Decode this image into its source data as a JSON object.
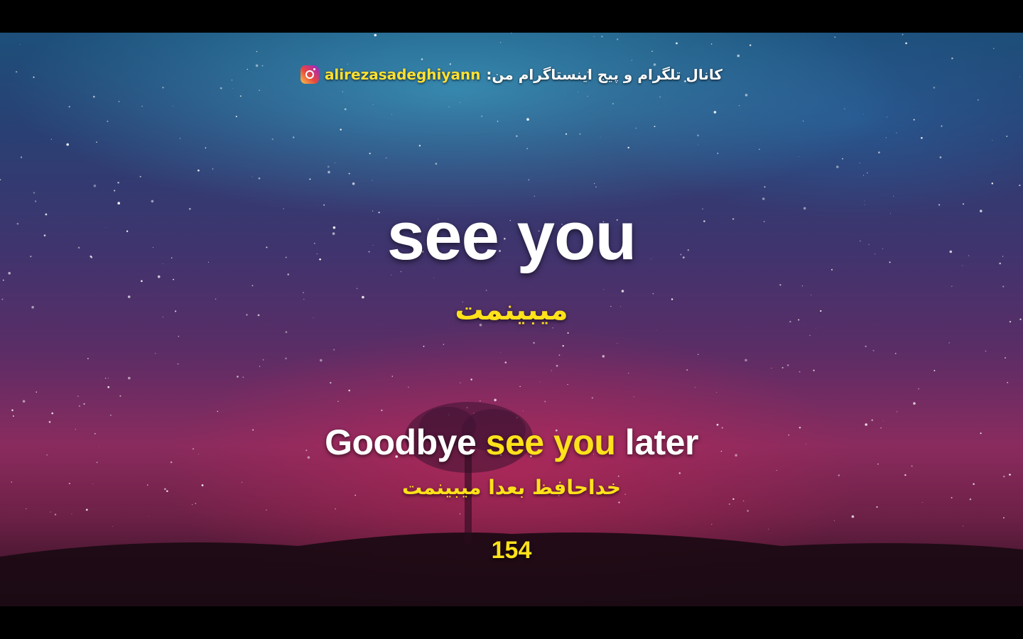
{
  "header": {
    "channel_label": "کانال تلگرام و پیج اینستاگرام من:",
    "handle": "alirezasadeghiyann",
    "icon": "instagram-icon"
  },
  "word": {
    "english": "see you",
    "persian": "میبینمت"
  },
  "sentence": {
    "before": "Goodbye",
    "highlight": "see you",
    "after": "later",
    "persian": "خداحافظ بعدا میبینمت"
  },
  "counter": "154",
  "colors": {
    "highlight": "#ffe21a",
    "text": "#ffffff",
    "letterbox": "#000000"
  }
}
